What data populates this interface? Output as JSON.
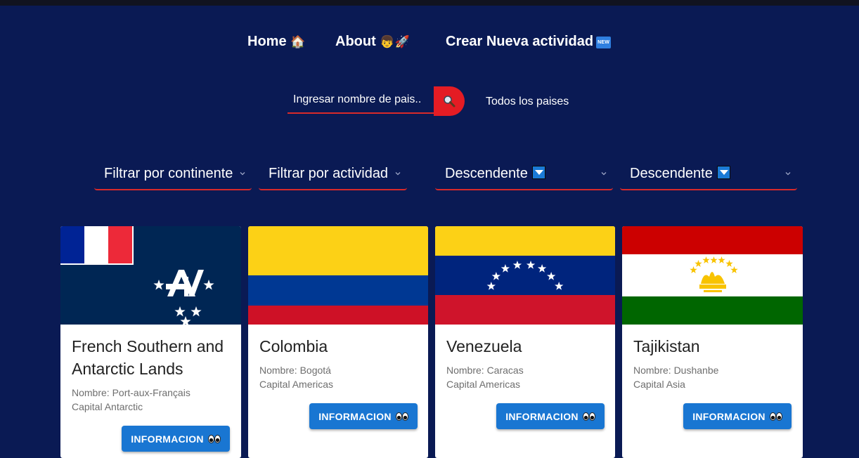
{
  "nav": {
    "home": "Home",
    "about": "About",
    "create": "Crear Nueva actividad",
    "new_badge": "NEW"
  },
  "search": {
    "placeholder": "Ingresar nombre de pais..",
    "all_label": "Todos los paises"
  },
  "filters": {
    "continent": "Filtrar por continente",
    "activity": "Filtrar por actividad",
    "order1": "Descendente",
    "order2": "Descendente"
  },
  "cards": [
    {
      "name": "French Southern and Antarctic Lands",
      "nombre": "Nombre: Port-aux-Français",
      "capital": "Capital Antarctic",
      "button": "INFORMACION"
    },
    {
      "name": "Colombia",
      "nombre": "Nombre: Bogotá",
      "capital": "Capital Americas",
      "button": "INFORMACION"
    },
    {
      "name": "Venezuela",
      "nombre": "Nombre: Caracas",
      "capital": "Capital Americas",
      "button": "INFORMACION"
    },
    {
      "name": "Tajikistan",
      "nombre": "Nombre: Dushanbe",
      "capital": "Capital Asia",
      "button": "INFORMACION"
    }
  ],
  "colors": {
    "background": "#0a1a54",
    "accent_red": "#e41c24",
    "button_blue": "#1976d2"
  }
}
